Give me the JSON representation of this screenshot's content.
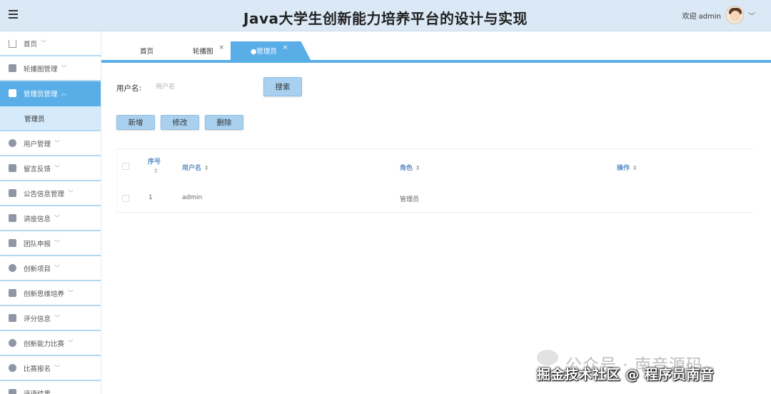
{
  "header": {
    "title": "Java大学生创新能力培养平台的设计与实现",
    "welcome": "欢迎 admin",
    "chevron": "﹀"
  },
  "sidebar": {
    "items": [
      {
        "label": "首页",
        "icon": "home-icon"
      },
      {
        "label": "轮播图管理",
        "icon": "image-icon"
      },
      {
        "label": "管理员管理",
        "icon": "grid-icon",
        "active": true
      },
      {
        "label": "管理员",
        "sub": true
      },
      {
        "label": "用户管理",
        "icon": "user-icon"
      },
      {
        "label": "留言反馈",
        "icon": "message-icon"
      },
      {
        "label": "公告信息管理",
        "icon": "notice-icon"
      },
      {
        "label": "讲座信息",
        "icon": "lecture-icon"
      },
      {
        "label": "团队申报",
        "icon": "team-icon"
      },
      {
        "label": "创新项目",
        "icon": "project-icon"
      },
      {
        "label": "创新思维培养",
        "icon": "mail-icon"
      },
      {
        "label": "评分信息",
        "icon": "score-icon"
      },
      {
        "label": "创新能力比赛",
        "icon": "contest-icon"
      },
      {
        "label": "比赛报名",
        "icon": "signup-icon"
      },
      {
        "label": "评语结果",
        "icon": "comment-icon"
      }
    ]
  },
  "tabs": [
    {
      "label": "首页"
    },
    {
      "label": "轮播图",
      "close": "×"
    },
    {
      "label": "●管理员",
      "close": "×",
      "active": true
    }
  ],
  "search": {
    "label": "用户名:",
    "placeholder": "用户名",
    "button": "搜索"
  },
  "actions": {
    "add": "新增",
    "edit": "修改",
    "delete": "删除"
  },
  "table": {
    "columns": [
      "序号",
      "用户名",
      "角色",
      "操作"
    ],
    "sort_glyph": "⇕",
    "rows": [
      {
        "index": "1",
        "username": "admin",
        "role": "管理员"
      }
    ]
  },
  "watermark": {
    "line1": "公众号 · 南音源码",
    "line2": "掘金技术社区 @ 程序员南音"
  },
  "colors": {
    "header_bg": "#dbe9f6",
    "accent": "#5aaee8",
    "button_bg": "#a9d1ef",
    "submenu_bg": "#d5eafa"
  }
}
